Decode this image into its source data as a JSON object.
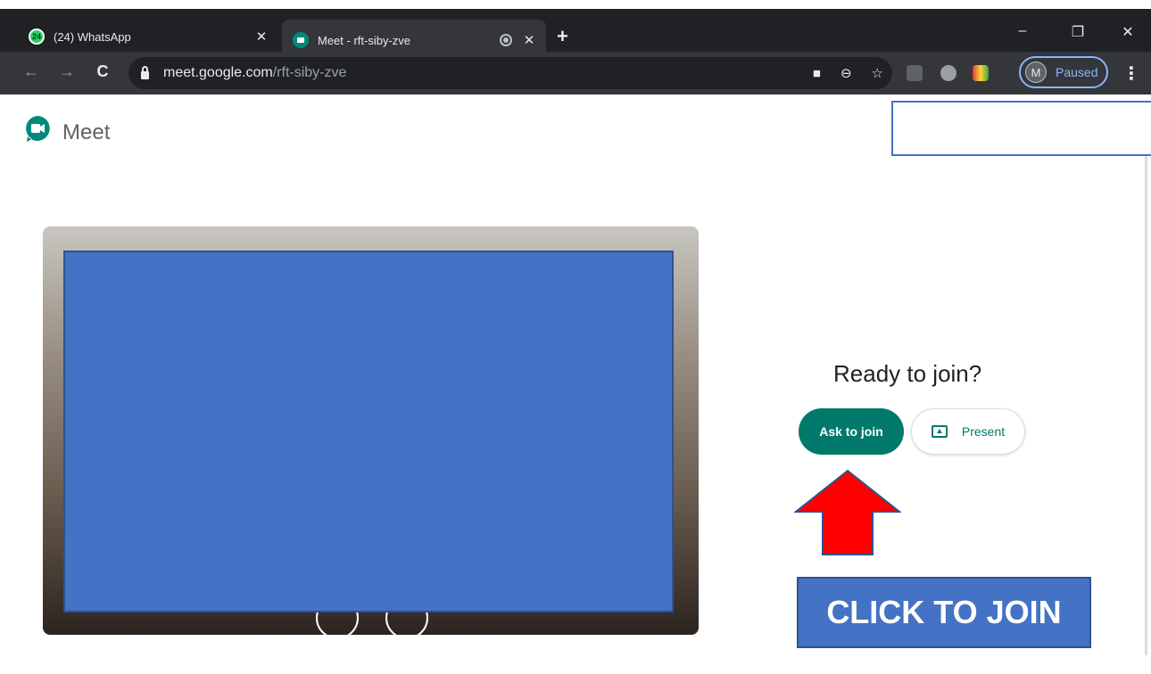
{
  "browser": {
    "tabs": [
      {
        "title": "(24) WhatsApp",
        "badge": "24",
        "active": false
      },
      {
        "title": "Meet - rft-siby-zve",
        "active": true
      }
    ],
    "new_tab_glyph": "+",
    "window_controls": {
      "minimize": "–",
      "restore": "❐",
      "close": "✕"
    },
    "url": {
      "host": "meet.google.com",
      "path": "/rft-siby-zve"
    },
    "profile": {
      "initial": "M",
      "status": "Paused"
    },
    "menu_glyph": "⋮"
  },
  "meet": {
    "app_name": "Meet",
    "ready_text": "Ready to join?",
    "ask_to_join_label": "Ask to join",
    "present_label": "Present",
    "accent_color": "#00796b"
  },
  "annotations": {
    "callout_text": "CLICK TO JOIN",
    "callout_color": "#4472c4",
    "arrow_color": "#ff0000"
  }
}
